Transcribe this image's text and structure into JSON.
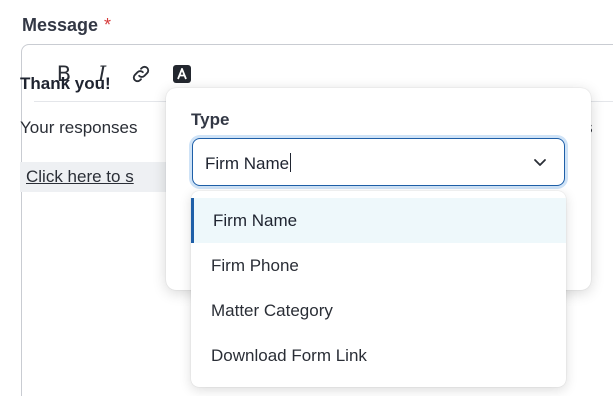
{
  "field": {
    "label": "Message",
    "required_marker": "*"
  },
  "toolbar": {
    "bold_label": "B",
    "italic_label": "I",
    "link_icon": "link-icon",
    "variable_icon": "variable-icon"
  },
  "content": {
    "title": "Thank you!",
    "body": "Your responses",
    "body_right": "u s",
    "link_text": "Click here to s"
  },
  "popover": {
    "type_label": "Type",
    "select_value": "Firm Name",
    "chevron_icon": "chevron-down-icon",
    "options": [
      {
        "label": "Firm Name",
        "selected": true
      },
      {
        "label": "Firm Phone",
        "selected": false
      },
      {
        "label": "Matter Category",
        "selected": false
      },
      {
        "label": "Download Form Link",
        "selected": false
      }
    ]
  },
  "colors": {
    "accent": "#1e5fa8",
    "focus_ring": "#cfe3f7",
    "selected_bg": "#eef8fb",
    "required": "#d63a3a"
  }
}
